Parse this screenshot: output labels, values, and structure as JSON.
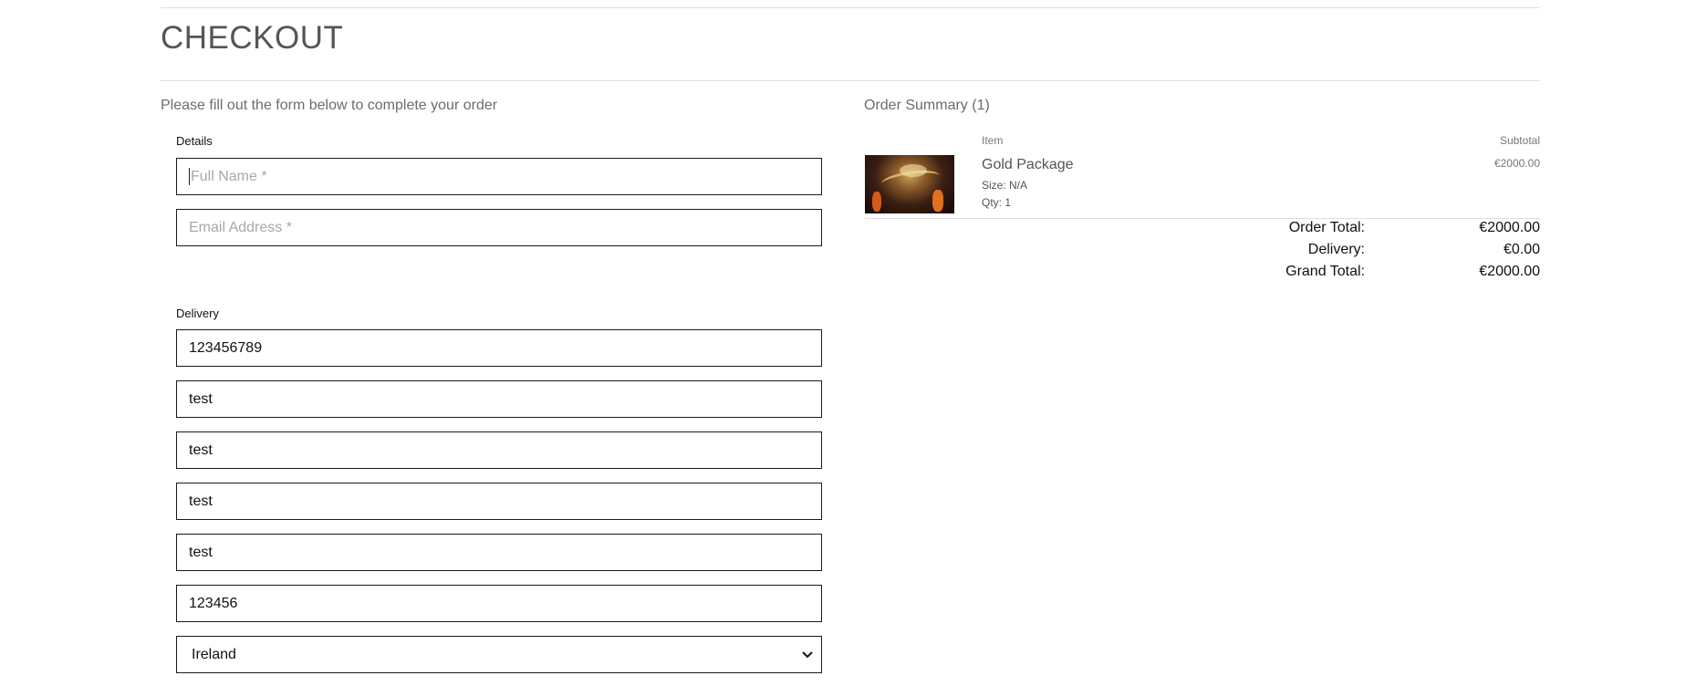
{
  "page": {
    "title": "CHECKOUT",
    "intro": "Please fill out the form below to complete your order"
  },
  "form": {
    "details_label": "Details",
    "full_name": {
      "value": "",
      "placeholder": "Full Name *"
    },
    "email": {
      "value": "",
      "placeholder": "Email Address *"
    },
    "delivery_label": "Delivery",
    "delivery_fields": [
      "123456789",
      "test",
      "test",
      "test",
      "test",
      "123456"
    ],
    "country": {
      "selected": "Ireland"
    }
  },
  "summary": {
    "title": "Order Summary (1)",
    "col_item": "Item",
    "col_subtotal": "Subtotal",
    "item": {
      "name": "Gold Package",
      "size": "Size: N/A",
      "qty": "Qty: 1",
      "subtotal": "€2000.00"
    },
    "order_total_label": "Order Total:",
    "order_total": "€2000.00",
    "delivery_label": "Delivery:",
    "delivery": "€0.00",
    "grand_total_label": "Grand Total:",
    "grand_total": "€2000.00"
  },
  "icons": {
    "select": "chevron-down-icon"
  }
}
